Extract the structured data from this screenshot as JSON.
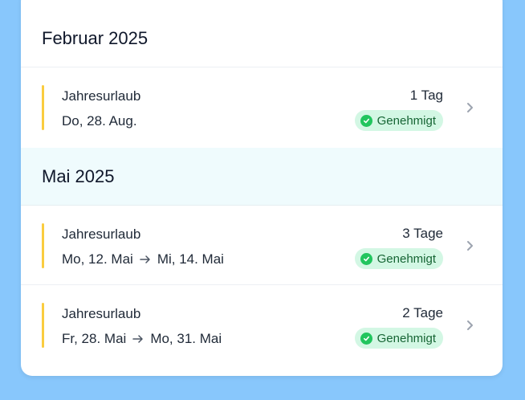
{
  "groups": [
    {
      "title": "Februar 2025",
      "entries": [
        {
          "type": "Jahresurlaub",
          "start": "Do, 28. Aug.",
          "end": "",
          "duration": "1 Tag",
          "status": "Genehmigt"
        }
      ]
    },
    {
      "title": "Mai 2025",
      "entries": [
        {
          "type": "Jahresurlaub",
          "start": "Mo, 12. Mai",
          "end": "Mi, 14. Mai",
          "duration": "3 Tage",
          "status": "Genehmigt"
        },
        {
          "type": "Jahresurlaub",
          "start": "Fr, 28. Mai",
          "end": "Mo, 31. Mai",
          "duration": "2 Tage",
          "status": "Genehmigt"
        }
      ]
    }
  ],
  "icons": {
    "status": "check-circle-icon",
    "row": "chevron-right-icon",
    "range": "arrow-right-icon"
  },
  "colors": {
    "accent": "#facc3f",
    "badge_bg": "#d3f7e4",
    "badge_text": "#166534",
    "check": "#22c55e",
    "page_bg": "#88c7fc"
  }
}
